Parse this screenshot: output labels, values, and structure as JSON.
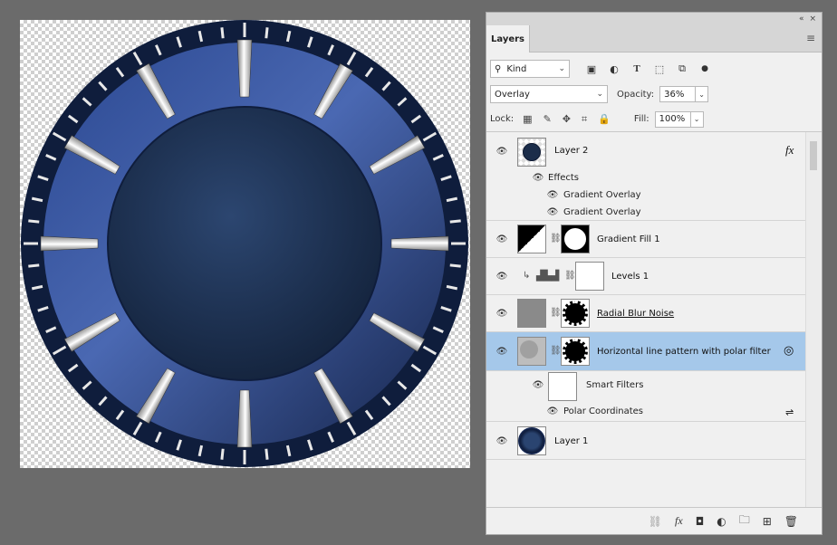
{
  "panel": {
    "collapse": "«",
    "close": "×",
    "tab_title": "Layers",
    "menu_icon": "≡",
    "kind_label": "Kind",
    "blend_mode": "Overlay",
    "opacity_label": "Opacity:",
    "opacity_value": "36%",
    "lock_label": "Lock:",
    "fill_label": "Fill:",
    "fill_value": "100%"
  },
  "layers": [
    {
      "name": "Layer 2",
      "fx": "fx"
    },
    {
      "name": "Effects"
    },
    {
      "name": "Gradient Overlay"
    },
    {
      "name": "Gradient Overlay"
    },
    {
      "name": "Gradient Fill 1"
    },
    {
      "name": "Levels 1"
    },
    {
      "name": "Radial Blur Noise"
    },
    {
      "name": "Horizontal line pattern with polar filter"
    },
    {
      "name": "Smart Filters"
    },
    {
      "name": "Polar Coordinates"
    },
    {
      "name": "Layer 1"
    }
  ],
  "icons": {
    "eye": "eye-icon",
    "chain": "link-icon",
    "search": "search-icon"
  },
  "colors": {
    "selection": "#a5c8ea",
    "dial_blue": "#1f3668",
    "dial_center": "#1b2d4a"
  }
}
